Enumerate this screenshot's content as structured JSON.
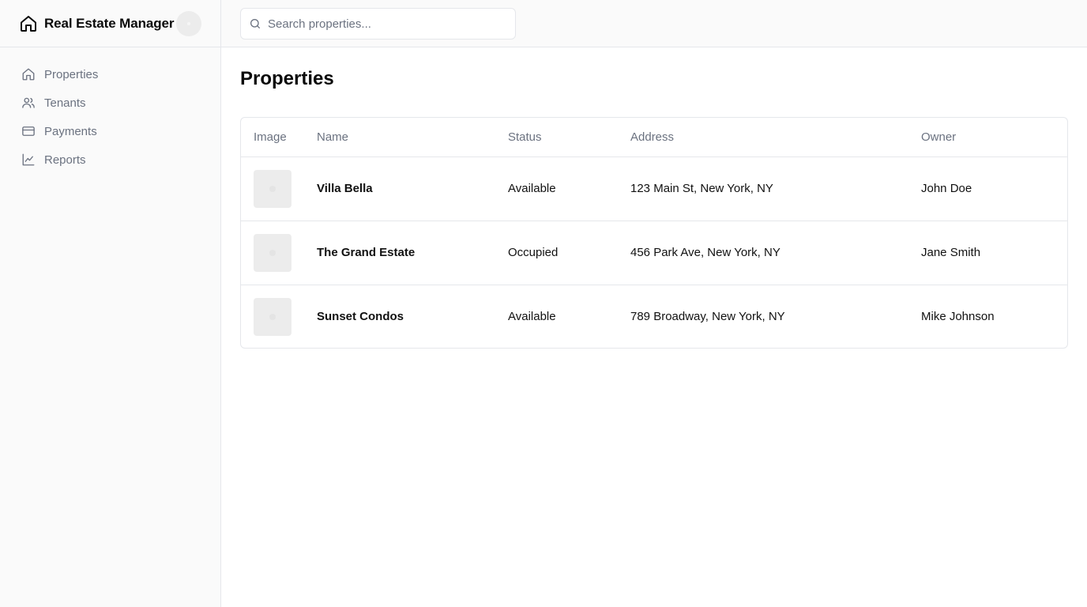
{
  "app": {
    "title": "Real Estate Manager",
    "logo_icon": "house-icon",
    "avatar_icon": "user-avatar"
  },
  "sidebar": {
    "items": [
      {
        "label": "Properties",
        "icon": "house-icon"
      },
      {
        "label": "Tenants",
        "icon": "users-icon"
      },
      {
        "label": "Payments",
        "icon": "credit-card-icon"
      },
      {
        "label": "Reports",
        "icon": "line-chart-icon"
      }
    ]
  },
  "header": {
    "search": {
      "placeholder": "Search properties...",
      "value": "",
      "icon": "search-icon"
    }
  },
  "main": {
    "title": "Properties",
    "table": {
      "columns": [
        "Image",
        "Name",
        "Status",
        "Address",
        "Owner"
      ],
      "rows": [
        {
          "name": "Villa Bella",
          "status": "Available",
          "address": "123 Main St, New York, NY",
          "owner": "John Doe"
        },
        {
          "name": "The Grand Estate",
          "status": "Occupied",
          "address": "456 Park Ave, New York, NY",
          "owner": "Jane Smith"
        },
        {
          "name": "Sunset Condos",
          "status": "Available",
          "address": "789 Broadway, New York, NY",
          "owner": "Mike Johnson"
        }
      ]
    }
  },
  "colors": {
    "sidebar_bg": "#fafafa",
    "border": "#e5e7eb",
    "muted_text": "#6b7280",
    "primary_text": "#0a0a0a",
    "placeholder_bg": "#ececec"
  }
}
